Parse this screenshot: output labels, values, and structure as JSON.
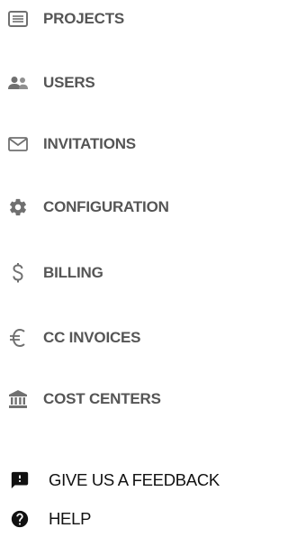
{
  "nav": {
    "items": [
      {
        "label": "PROJECTS",
        "icon": "list-icon"
      },
      {
        "label": "USERS",
        "icon": "users-icon"
      },
      {
        "label": "INVITATIONS",
        "icon": "mail-icon"
      },
      {
        "label": "CONFIGURATION",
        "icon": "gear-icon"
      },
      {
        "label": "BILLING",
        "icon": "dollar-icon"
      },
      {
        "label": "CC INVOICES",
        "icon": "euro-icon"
      },
      {
        "label": "COST CENTERS",
        "icon": "bank-icon"
      }
    ],
    "secondary": [
      {
        "label": "GIVE US A FEEDBACK",
        "icon": "feedback-icon"
      },
      {
        "label": "HELP",
        "icon": "help-icon"
      }
    ]
  },
  "colors": {
    "primary_text": "#555555",
    "icon_gray": "#707070",
    "secondary_text": "#111111"
  }
}
